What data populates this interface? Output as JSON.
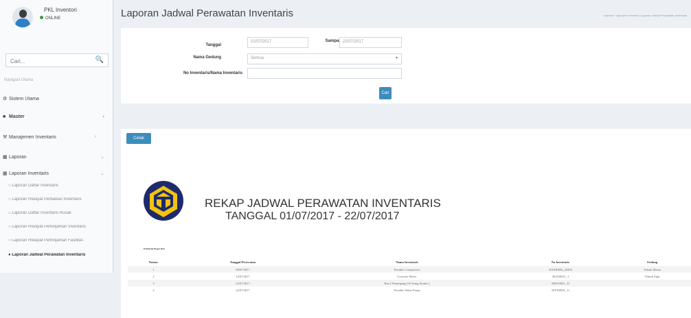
{
  "user": {
    "name": "PKL Inventori",
    "status": "ONLINE"
  },
  "sidebar": {
    "search_placeholder": "Cari...",
    "header": "Navigasi Utama",
    "items": [
      {
        "label": "Sistem Utama"
      },
      {
        "label": "Master"
      },
      {
        "label": "Manajemen Inventaris"
      },
      {
        "label": "Laporan"
      },
      {
        "label": "Laporan Inventaris"
      }
    ],
    "sub_items": [
      {
        "label": "Laporan Daftar Inventaris"
      },
      {
        "label": "Laporan Riwayat Perbaikan Inventaris"
      },
      {
        "label": "Laporan Daftar Inventaris Rusak"
      },
      {
        "label": "Laporan Riwayat Peminjaman Inventaris"
      },
      {
        "label": "Laporan Riwayat Peminjaman Fasilitas"
      },
      {
        "label": "Laporan Jadwal Perawatan Inventaris"
      }
    ]
  },
  "header": {
    "title": "Laporan Jadwal Perawatan Inventaris",
    "breadcrumb": "Laporan  /  Laporan Inventaris  /  Laporan Jadwal Perawatan Inventaris"
  },
  "filter": {
    "tanggal_label": "Tanggal",
    "tanggal_value": "01/07/2017",
    "sampai_label": "Sampai",
    "sampai_value": "22/07/2017",
    "gedung_label": "Nama Gedung",
    "gedung_value": "Semua",
    "noinv_label": "No Inventaris/Nama Inventaris",
    "noinv_value": "",
    "cari_label": "Cari"
  },
  "report": {
    "cetak_label": "Cetak",
    "title": "REKAP JADWAL PERAWATAN INVENTARIS",
    "subtitle": "TANGGAL 01/07/2017 - 22/07/2017",
    "logo_caption": "Politeknik Negeri Bali",
    "columns": [
      "Nomor",
      "Tanggal Perawatan",
      "Nama Inventaris",
      "No Inventaris",
      "Gedung"
    ],
    "rows": [
      [
        "1",
        "08/07/2017",
        "Portable Compressor",
        "301030002_43203",
        "Teknik Mesin"
      ],
      [
        "2",
        "14/07/2017",
        "Concrete Mixer",
        "301030011_1",
        "Teknik Sipil"
      ],
      [
        "3",
        "22/07/2017",
        "Bus ( Penumpang 16 Orang Keatas )",
        "302010001_21",
        ""
      ],
      [
        "4",
        "22/07/2017",
        "Portable Water Pump",
        "301050001_11",
        ""
      ]
    ]
  },
  "colors": {
    "primary": "#3c8dbc",
    "status": "#3c9a3c"
  }
}
